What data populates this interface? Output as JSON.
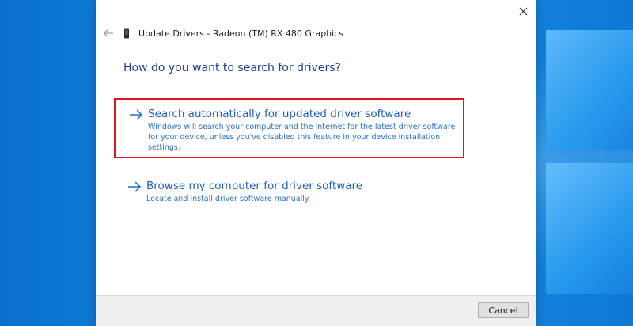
{
  "dialog": {
    "title": "Update Drivers - Radeon (TM) RX 480 Graphics",
    "heading": "How do you want to search for drivers?",
    "options": [
      {
        "title": "Search automatically for updated driver software",
        "description": "Windows will search your computer and the Internet for the latest driver software for your device, unless you've disabled this feature in your device installation settings.",
        "icon": "arrow-right-icon",
        "highlighted": true
      },
      {
        "title": "Browse my computer for driver software",
        "description": "Locate and install driver software manually.",
        "icon": "arrow-right-icon",
        "highlighted": false
      }
    ],
    "cancel_label": "Cancel"
  },
  "icons": {
    "close": "close-icon",
    "back": "back-arrow-icon",
    "device": "device-icon"
  },
  "colors": {
    "accent": "#1f5fc1",
    "heading": "#1c3f93",
    "highlight_border": "#e0161e",
    "desktop": "#138adf"
  }
}
